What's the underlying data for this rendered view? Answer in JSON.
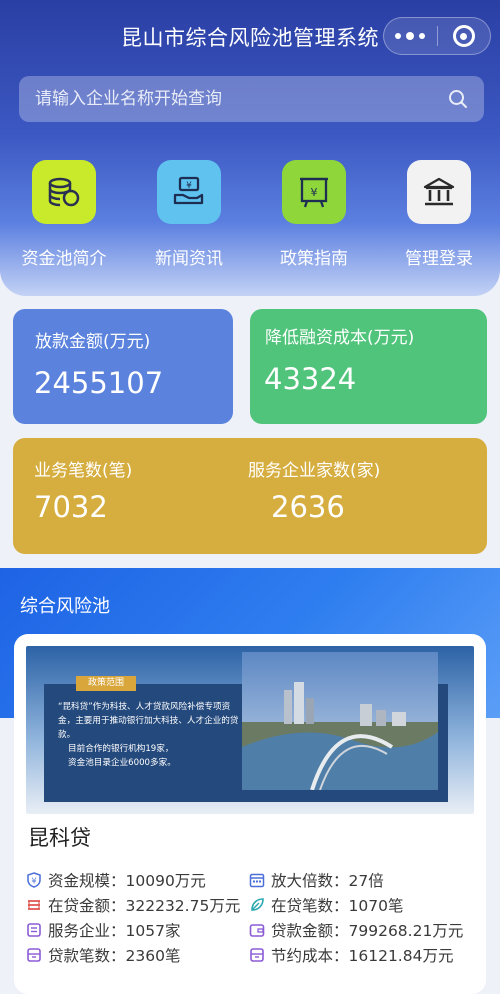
{
  "header": {
    "title": "昆山市综合风险池管理系统"
  },
  "search": {
    "placeholder": "请输入企业名称开始查询"
  },
  "menu": [
    {
      "label": "资金池简介",
      "icon": "coins-icon",
      "color": "#c9ea2b"
    },
    {
      "label": "新闻资讯",
      "icon": "money-hand-icon",
      "color": "#5fc2ef"
    },
    {
      "label": "政策指南",
      "icon": "policy-board-icon",
      "color": "#8ed63a"
    },
    {
      "label": "管理登录",
      "icon": "bank-building-icon",
      "color": "#f2f2f2"
    }
  ],
  "stats": {
    "loan": {
      "label": "放款金额(万元)",
      "value": "2455107",
      "color": "#5b83de"
    },
    "cost": {
      "label": "降低融资成本(万元)",
      "value": "43324",
      "color": "#4fc47a"
    },
    "count": {
      "label": "业务笔数(笔)",
      "value": "7032"
    },
    "firms": {
      "label": "服务企业家数(家)",
      "value": "2636"
    },
    "yellow": "#d6ad3f"
  },
  "section": {
    "title": "综合风险池"
  },
  "product": {
    "name": "昆科贷",
    "banner": {
      "tag": "政策范围",
      "text1": "“昆科贷”作为科技、人才贷款风险补偿专项资金，主要用于推动银行加大科技、人才企业的贷款。",
      "text2": "目前合作的银行机构19家，",
      "text3": "资金池目录企业6000多家。"
    },
    "info": [
      {
        "text": "资金规模：10090万元",
        "icon": "yen-shield-icon",
        "color": "#4a6fd8"
      },
      {
        "text": "放大倍数：27倍",
        "icon": "calendar-icon",
        "color": "#4a6fd8"
      },
      {
        "text": "在贷金额：322232.75万元",
        "icon": "stack-icon",
        "color": "#e0544e"
      },
      {
        "text": "在贷笔数：1070笔",
        "icon": "leaf-icon",
        "color": "#2aa7b0"
      },
      {
        "text": "服务企业：1057家",
        "icon": "building-icon",
        "color": "#8b5bd6"
      },
      {
        "text": "贷款金额：799268.21万元",
        "icon": "wallet-icon",
        "color": "#8b5bd6"
      },
      {
        "text": "贷款笔数：2360笔",
        "icon": "box-icon",
        "color": "#8b5bd6"
      },
      {
        "text": "节约成本：16121.84万元",
        "icon": "box-icon",
        "color": "#8b5bd6"
      }
    ]
  }
}
